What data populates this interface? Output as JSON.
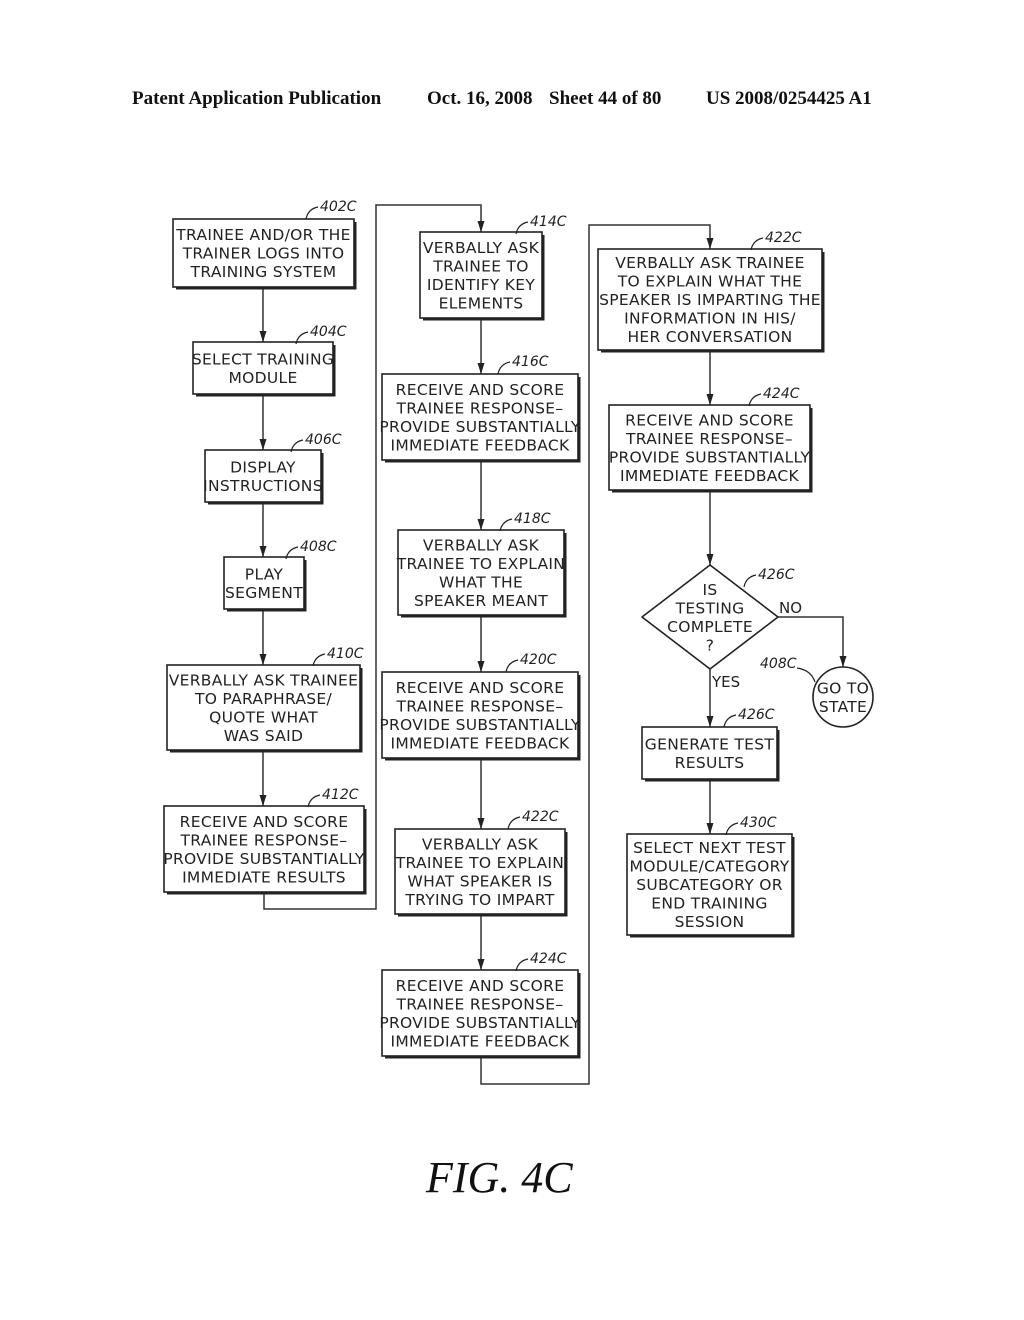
{
  "header": {
    "publication": "Patent Application Publication",
    "date": "Oct. 16, 2008",
    "sheet": "Sheet 44 of 80",
    "number": "US 2008/0254425 A1"
  },
  "figure_label": "FIG.  4C",
  "nodes": [
    {
      "id": "402C",
      "ref": "402C",
      "shape": "box",
      "lines": [
        "TRAINEE AND/OR THE",
        "TRAINER LOGS INTO",
        "TRAINING SYSTEM"
      ]
    },
    {
      "id": "404C",
      "ref": "404C",
      "shape": "box",
      "lines": [
        "SELECT TRAINING",
        "MODULE"
      ]
    },
    {
      "id": "406C",
      "ref": "406C",
      "shape": "box",
      "lines": [
        "DISPLAY",
        "INSTRUCTIONS"
      ]
    },
    {
      "id": "408C",
      "ref": "408C",
      "shape": "box",
      "lines": [
        "PLAY",
        "SEGMENT"
      ]
    },
    {
      "id": "410C",
      "ref": "410C",
      "shape": "box",
      "lines": [
        "VERBALLY ASK TRAINEE",
        "TO PARAPHRASE/",
        "QUOTE WHAT",
        "WAS SAID"
      ]
    },
    {
      "id": "412C",
      "ref": "412C",
      "shape": "box",
      "lines": [
        "RECEIVE AND SCORE",
        "TRAINEE RESPONSE–",
        "PROVIDE SUBSTANTIALLY",
        "IMMEDIATE RESULTS"
      ]
    },
    {
      "id": "414C",
      "ref": "414C",
      "shape": "box",
      "lines": [
        "VERBALLY ASK",
        "TRAINEE TO",
        "IDENTIFY KEY",
        "ELEMENTS"
      ]
    },
    {
      "id": "416C",
      "ref": "416C",
      "shape": "box",
      "lines": [
        "RECEIVE AND SCORE",
        "TRAINEE RESPONSE–",
        "PROVIDE SUBSTANTIALLY",
        "IMMEDIATE FEEDBACK"
      ]
    },
    {
      "id": "418C",
      "ref": "418C",
      "shape": "box",
      "lines": [
        "VERBALLY ASK",
        "TRAINEE TO EXPLAIN",
        "WHAT THE",
        "SPEAKER MEANT"
      ]
    },
    {
      "id": "420C",
      "ref": "420C",
      "shape": "box",
      "lines": [
        "RECEIVE AND SCORE",
        "TRAINEE RESPONSE–",
        "PROVIDE SUBSTANTIALLY",
        "IMMEDIATE FEEDBACK"
      ]
    },
    {
      "id": "422C-a",
      "ref": "422C",
      "shape": "box",
      "lines": [
        "VERBALLY ASK",
        "TRAINEE TO EXPLAIN",
        "WHAT SPEAKER IS",
        "TRYING TO IMPART"
      ]
    },
    {
      "id": "424C-a",
      "ref": "424C",
      "shape": "box",
      "lines": [
        "RECEIVE AND SCORE",
        "TRAINEE RESPONSE–",
        "PROVIDE SUBSTANTIALLY",
        "IMMEDIATE FEEDBACK"
      ]
    },
    {
      "id": "422C-b",
      "ref": "422C",
      "shape": "box",
      "lines": [
        "VERBALLY ASK TRAINEE",
        "TO EXPLAIN WHAT THE",
        "SPEAKER IS IMPARTING THE",
        "INFORMATION IN HIS/",
        "HER CONVERSATION"
      ]
    },
    {
      "id": "424C-b",
      "ref": "424C",
      "shape": "box",
      "lines": [
        "RECEIVE AND SCORE",
        "TRAINEE RESPONSE–",
        "PROVIDE SUBSTANTIALLY",
        "IMMEDIATE FEEDBACK"
      ]
    },
    {
      "id": "426C-d",
      "ref": "426C",
      "shape": "diamond",
      "lines": [
        "IS",
        "TESTING",
        "COMPLETE",
        "?"
      ]
    },
    {
      "id": "408C-c",
      "ref": "408C",
      "shape": "circle",
      "lines": [
        "GO TO",
        "STATE"
      ]
    },
    {
      "id": "426C-b",
      "ref": "426C",
      "shape": "box",
      "lines": [
        "GENERATE TEST",
        "RESULTS"
      ]
    },
    {
      "id": "430C",
      "ref": "430C",
      "shape": "box",
      "lines": [
        "SELECT NEXT TEST",
        "MODULE/CATEGORY",
        "SUBCATEGORY OR",
        "END TRAINING",
        "SESSION"
      ]
    }
  ],
  "edges": [
    {
      "from": "402C",
      "to": "404C"
    },
    {
      "from": "404C",
      "to": "406C"
    },
    {
      "from": "406C",
      "to": "408C"
    },
    {
      "from": "408C",
      "to": "410C"
    },
    {
      "from": "410C",
      "to": "412C"
    },
    {
      "from": "412C",
      "to": "414C"
    },
    {
      "from": "414C",
      "to": "416C"
    },
    {
      "from": "416C",
      "to": "418C"
    },
    {
      "from": "418C",
      "to": "420C"
    },
    {
      "from": "420C",
      "to": "422C-a"
    },
    {
      "from": "422C-a",
      "to": "424C-a"
    },
    {
      "from": "424C-a",
      "to": "422C-b"
    },
    {
      "from": "422C-b",
      "to": "424C-b"
    },
    {
      "from": "424C-b",
      "to": "426C-d"
    },
    {
      "from": "426C-d",
      "to": "408C-c",
      "label": "NO"
    },
    {
      "from": "426C-d",
      "to": "426C-b",
      "label": "YES"
    },
    {
      "from": "426C-b",
      "to": "430C"
    }
  ]
}
